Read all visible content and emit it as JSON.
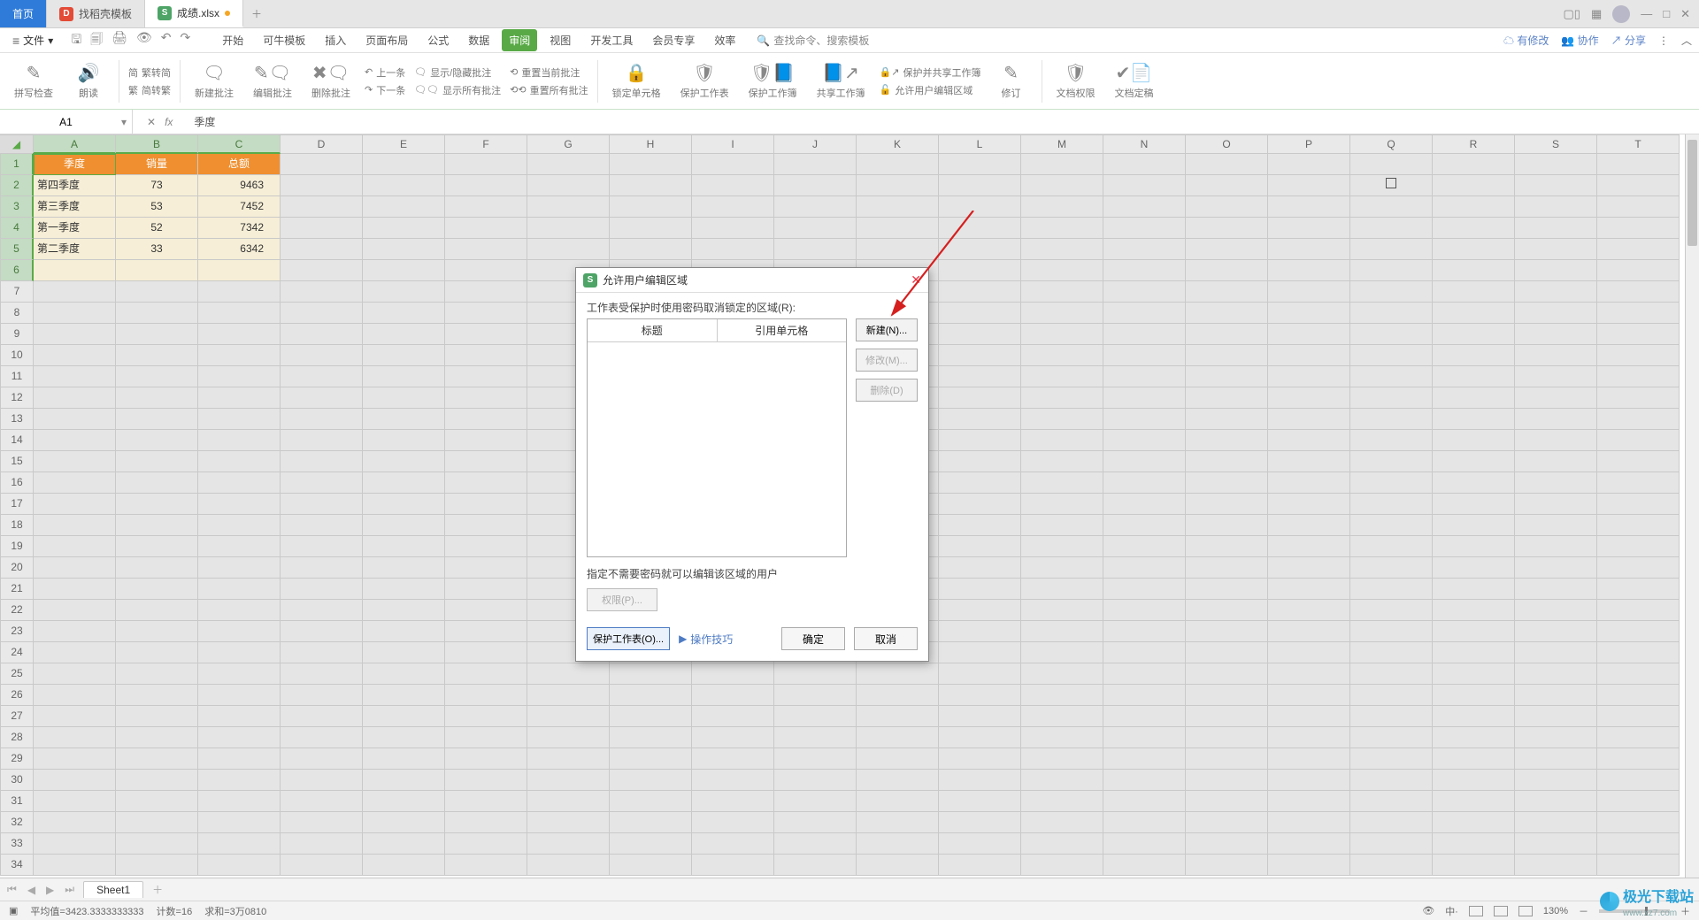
{
  "tabs": {
    "home": "首页",
    "template": "找稻壳模板",
    "file": "成绩.xlsx"
  },
  "menubar": {
    "file": "文件",
    "items": [
      "开始",
      "可牛模板",
      "插入",
      "页面布局",
      "公式",
      "数据",
      "审阅",
      "视图",
      "开发工具",
      "会员专享",
      "效率"
    ],
    "search_ph": "查找命令、搜索模板",
    "cloud": "有修改",
    "coop": "协作",
    "share": "分享"
  },
  "ribbon": {
    "spell": "拼写检查",
    "read": "朗读",
    "simp": "繁转简",
    "simp2": "简转繁",
    "newc": "新建批注",
    "editc": "编辑批注",
    "delc": "删除批注",
    "prev": "上一条",
    "next": "下一条",
    "show": "显示/隐藏批注",
    "showall": "显示所有批注",
    "reset": "重置当前批注",
    "resetall": "重置所有批注",
    "lockcell": "锁定单元格",
    "protws": "保护工作表",
    "protwb": "保护工作簿",
    "sharewb": "共享工作簿",
    "protsh": "保护并共享工作簿",
    "allowedit": "允许用户编辑区域",
    "track": "修订",
    "docperm": "文档权限",
    "docfinal": "文档定稿"
  },
  "namebox": "A1",
  "fx_value": "季度",
  "columns": [
    "A",
    "B",
    "C",
    "D",
    "E",
    "F",
    "G",
    "H",
    "I",
    "J",
    "K",
    "L",
    "M",
    "N",
    "O",
    "P",
    "Q",
    "R",
    "S",
    "T"
  ],
  "headers": [
    "季度",
    "销量",
    "总额"
  ],
  "rows": [
    {
      "c0": "第四季度",
      "c1": "73",
      "c2": "9463"
    },
    {
      "c0": "第三季度",
      "c1": "53",
      "c2": "7452"
    },
    {
      "c0": "第一季度",
      "c1": "52",
      "c2": "7342"
    },
    {
      "c0": "第二季度",
      "c1": "33",
      "c2": "6342"
    }
  ],
  "sheet_tab": "Sheet1",
  "status": {
    "avg": "平均值=3423.3333333333",
    "count": "计数=16",
    "sum": "求和=3万0810",
    "zoom": "130%"
  },
  "dialog": {
    "title": "允许用户编辑区域",
    "label1": "工作表受保护时使用密码取消锁定的区域(R):",
    "col1": "标题",
    "col2": "引用单元格",
    "new": "新建(N)...",
    "mod": "修改(M)...",
    "del": "删除(D)",
    "note": "指定不需要密码就可以编辑该区域的用户",
    "perm": "权限(P)...",
    "protect": "保护工作表(O)...",
    "tips": "操作技巧",
    "ok": "确定",
    "cancel": "取消"
  },
  "watermark": {
    "name": "极光下载站",
    "url": "www.xz7.com"
  }
}
